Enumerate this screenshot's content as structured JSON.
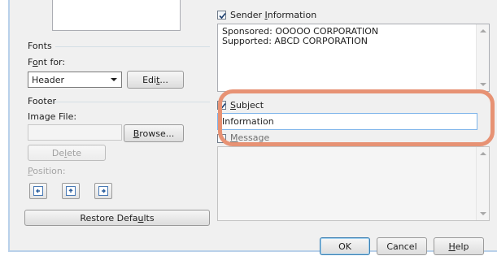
{
  "fonts": {
    "group_label": "Fonts",
    "font_for_label": "Font for:",
    "font_for_value": "Header",
    "edit_button": "Edit..."
  },
  "footer": {
    "group_label": "Footer",
    "image_file_label": "Image File:",
    "image_file_value": "",
    "browse_button": "Browse...",
    "delete_button": "Delete",
    "position_label": "Position:"
  },
  "restore_defaults_button": "Restore Defaults",
  "sender_information": {
    "checkbox_label": "Sender Information",
    "checked": true,
    "lines": [
      "Sponsored: OOOOO CORPORATION",
      "Supported: ABCD CORPORATION"
    ]
  },
  "subject": {
    "checkbox_label": "Subject",
    "checked": true,
    "value": "Information"
  },
  "message": {
    "checkbox_label": "Message",
    "checked": false
  },
  "dialog_buttons": {
    "ok": "OK",
    "cancel": "Cancel",
    "help": "Help"
  },
  "colors": {
    "highlight": "#e79274",
    "dialog_background": "#f0f0f0"
  }
}
